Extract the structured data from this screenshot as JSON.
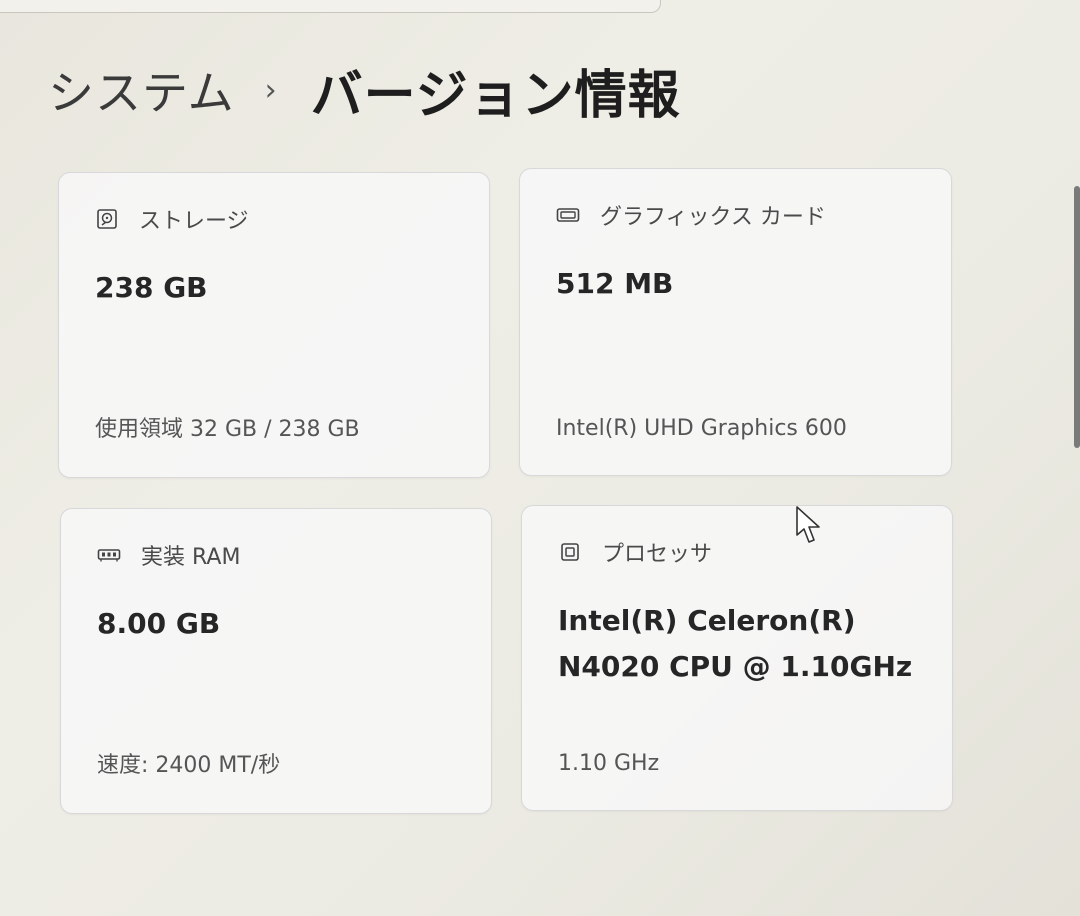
{
  "breadcrumb": {
    "parent": "システム",
    "separator": "›",
    "current": "バージョン情報"
  },
  "cards": {
    "storage": {
      "icon": "storage-drive-icon",
      "label": "ストレージ",
      "value": "238 GB",
      "detail": "使用領域 32 GB / 238 GB"
    },
    "graphics": {
      "icon": "graphics-card-icon",
      "label": "グラフィックス カード",
      "value": "512 MB",
      "detail": "Intel(R) UHD Graphics 600"
    },
    "ram": {
      "icon": "memory-module-icon",
      "label": "実装 RAM",
      "value": "8.00 GB",
      "detail": "速度: 2400 MT/秒"
    },
    "processor": {
      "icon": "processor-chip-icon",
      "label": "プロセッサ",
      "value_line1": "Intel(R) Celeron(R)",
      "value_line2": "N4020 CPU @ 1.10GHz",
      "detail": "1.10 GHz"
    }
  }
}
